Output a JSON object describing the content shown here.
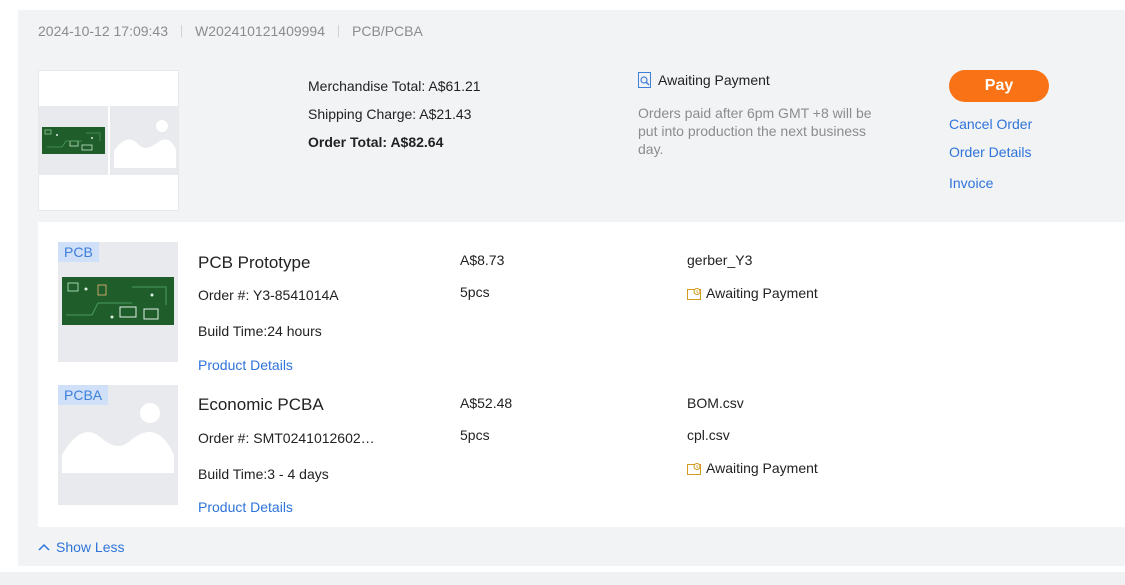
{
  "order": {
    "datetime": "2024-10-12 17:09:43",
    "order_no": "W202410121409994",
    "category": "PCB/PCBA",
    "merchandise_total": "Merchandise Total: A$61.21",
    "shipping_charge": "Shipping Charge: A$21.43",
    "order_total": "Order Total: A$82.64",
    "status": "Awaiting Payment",
    "status_note": "Orders paid after 6pm GMT +8 will be put into production the next business day.",
    "actions": {
      "pay": "Pay",
      "cancel": "Cancel Order",
      "details": "Order Details",
      "invoice": "Invoice"
    }
  },
  "items": [
    {
      "tag": "PCB",
      "title": "PCB Prototype",
      "order_no": "Order #: Y3-8541014A",
      "build_time": "Build Time:24 hours",
      "product_details": "Product Details",
      "price": "A$8.73",
      "qty": "5pcs",
      "files": [
        "gerber_Y3"
      ],
      "status": "Awaiting Payment"
    },
    {
      "tag": "PCBA",
      "title": "Economic PCBA",
      "order_no": "Order #: SMT0241012602…",
      "build_time": "Build Time:3 - 4 days",
      "product_details": "Product Details",
      "price": "A$52.48",
      "qty": "5pcs",
      "files": [
        "BOM.csv",
        "cpl.csv"
      ],
      "status": "Awaiting Payment"
    }
  ],
  "show_less": "Show Less",
  "colors": {
    "accent": "#f97316",
    "link": "#2e74d9",
    "card_bg": "#f2f3f5",
    "tag_bg": "#cfe0f8",
    "pcb_green": "#1f5d2a"
  }
}
